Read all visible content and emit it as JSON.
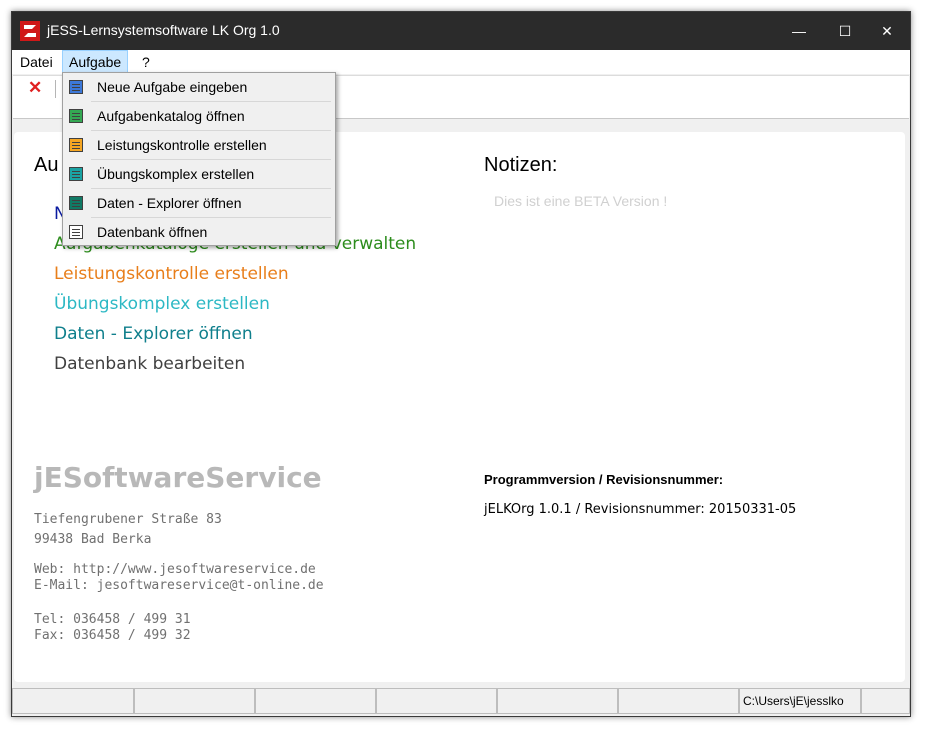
{
  "window": {
    "title": "jESS-Lernsystemsoftware LK Org 1.0",
    "controls": {
      "minimize": "—",
      "maximize": "☐",
      "close": "✕"
    }
  },
  "menu": {
    "datei": "Datei",
    "aufgabe": "Aufgabe",
    "help": "?"
  },
  "toolbar": {
    "close_glyph": "✕"
  },
  "dropdown": {
    "items": [
      {
        "label": "Neue Aufgabe eingeben",
        "icon": "document-blue-icon",
        "color": "#3c78d8"
      },
      {
        "label": "Aufgabenkatalog öffnen",
        "icon": "document-green-icon",
        "color": "#34a853"
      },
      {
        "label": "Leistungskontrolle erstellen",
        "icon": "document-orange-icon",
        "color": "#f5a623"
      },
      {
        "label": "Übungskomplex erstellen",
        "icon": "document-teal-icon",
        "color": "#1aa3a3"
      },
      {
        "label": "Daten - Explorer öffnen",
        "icon": "folder-teal-icon",
        "color": "#117a65"
      },
      {
        "label": "Datenbank öffnen",
        "icon": "document-white-icon",
        "color": "#ffffff"
      }
    ]
  },
  "main": {
    "section_title": "Au",
    "links": [
      {
        "text": "N",
        "color": "#0a1aa0"
      },
      {
        "text": "Aufgabenkataloge erstellen und verwalten",
        "color": "#2c8c1c"
      },
      {
        "text": "Leistungskontrolle erstellen",
        "color": "#e87e1a"
      },
      {
        "text": "Übungskomplex erstellen",
        "color": "#2cb8c4"
      },
      {
        "text": "Daten - Explorer öffnen",
        "color": "#0f7f8c"
      },
      {
        "text": "Datenbank bearbeiten",
        "color": "#404040"
      }
    ],
    "notes_title": "Notizen:",
    "notes_text": "Dies ist eine BETA Version !",
    "company": "jESoftwareService",
    "street": "Tiefengrubener Straße 83",
    "city": "99438 Bad Berka",
    "web": "Web: http://www.jesoftwareservice.de",
    "email": "E-Mail: jesoftwareservice@t-online.de",
    "tel": "Tel: 036458 / 499 31",
    "fax": "Fax: 036458 / 499 32",
    "version_label": "Programmversion / Revisionsnummer:",
    "version_value": "jELKOrg 1.0.1 / Revisionsnummer: 20150331-05"
  },
  "statusbar": {
    "path": "C:\\Users\\jE\\jesslko"
  }
}
